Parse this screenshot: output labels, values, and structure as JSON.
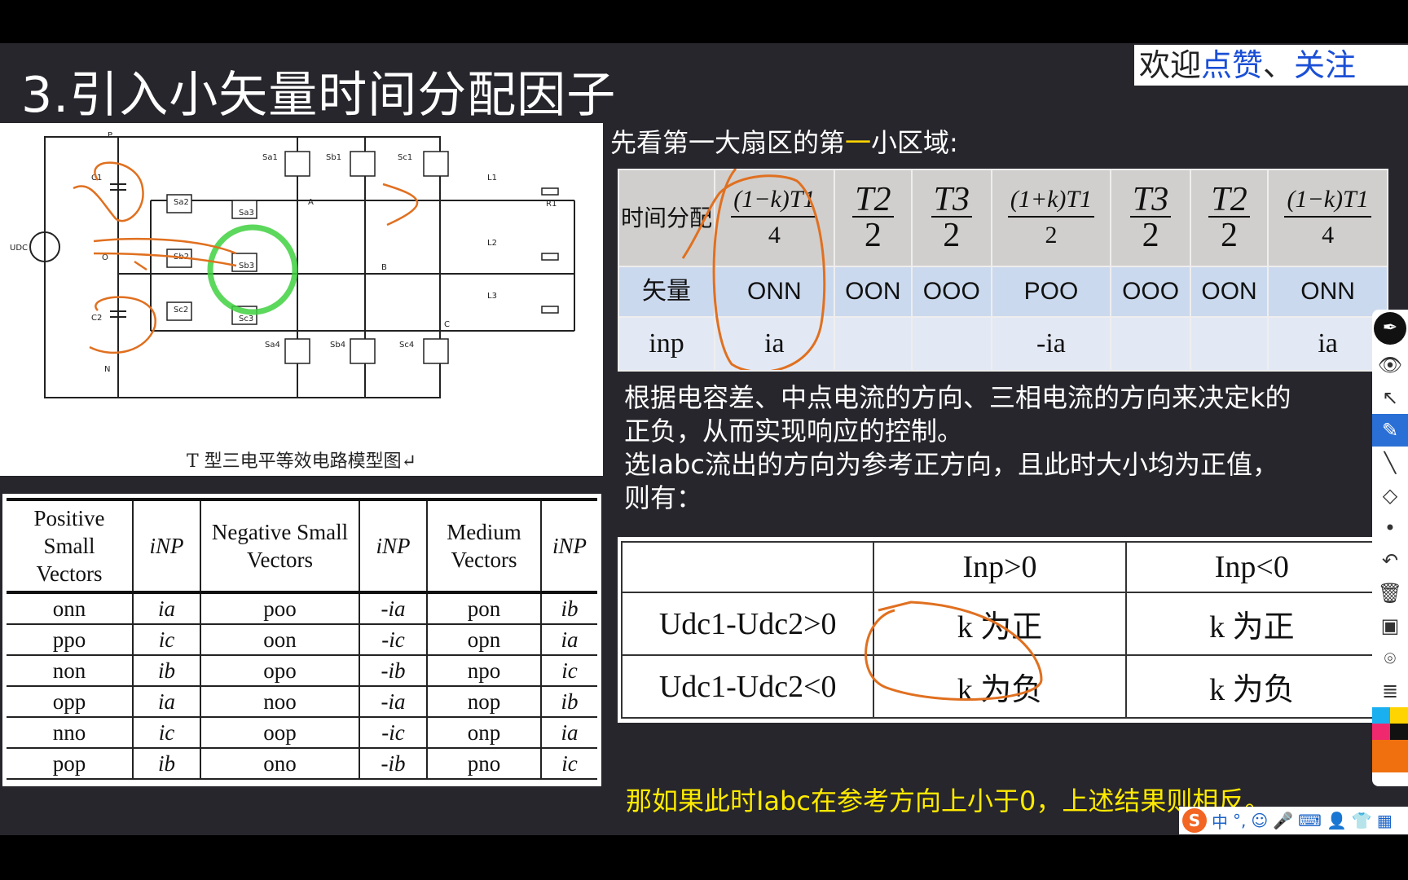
{
  "slide": {
    "title": "3.引入小矢量时间分配因子",
    "welcome_prefix": "欢迎",
    "welcome_blue1": "点赞",
    "welcome_sep": "、",
    "welcome_blue2": "关注"
  },
  "circuit": {
    "caption": "T 型三电平等效电路模型图↵",
    "labels": {
      "P": "P",
      "O": "O",
      "N": "N",
      "Udc": "UDC",
      "C1": "C1",
      "C2": "C2",
      "A": "A",
      "B": "B",
      "C": "C",
      "L1": "L1",
      "L2": "L2",
      "L3": "L3",
      "R1": "R1",
      "Sa1": "Sa1",
      "Sb1": "Sb1",
      "Sc1": "Sc1",
      "Sa2": "Sa2",
      "Sb2": "Sb2",
      "Sc2": "Sc2",
      "Sa3": "Sa3",
      "Sb3": "Sb3",
      "Sc3": "Sc3",
      "Sa4": "Sa4",
      "Sb4": "Sb4",
      "Sc4": "Sc4"
    }
  },
  "vector_table": {
    "headers": [
      "Positive Small Vectors",
      "iNP",
      "Negative Small Vectors",
      "iNP",
      "Medium Vectors",
      "iNP"
    ],
    "rows": [
      [
        "onn",
        "ia",
        "poo",
        "-ia",
        "pon",
        "ib"
      ],
      [
        "ppo",
        "ic",
        "oon",
        "-ic",
        "opn",
        "ia"
      ],
      [
        "non",
        "ib",
        "opo",
        "-ib",
        "npo",
        "ic"
      ],
      [
        "opp",
        "ia",
        "noo",
        "-ia",
        "nop",
        "ib"
      ],
      [
        "nno",
        "ic",
        "oop",
        "-ic",
        "onp",
        "ia"
      ],
      [
        "pop",
        "ib",
        "ono",
        "-ib",
        "pno",
        "ic"
      ]
    ]
  },
  "heading": {
    "pre": "先看第一大扇区的第",
    "hl": "一",
    "post": "小区域:"
  },
  "time_table": {
    "row_labels": [
      "时间分配",
      "矢量",
      "inp"
    ],
    "time": [
      {
        "n": "(1−k)T1",
        "d": "4"
      },
      {
        "n": "T2",
        "d": "2"
      },
      {
        "n": "T3",
        "d": "2"
      },
      {
        "n": "(1+k)T1",
        "d": "2"
      },
      {
        "n": "T3",
        "d": "2"
      },
      {
        "n": "T2",
        "d": "2"
      },
      {
        "n": "(1−k)T1",
        "d": "4"
      }
    ],
    "vectors": [
      "ONN",
      "OON",
      "OOO",
      "POO",
      "OOO",
      "OON",
      "ONN"
    ],
    "inp": [
      "ia",
      "",
      "",
      "-ia",
      "",
      "",
      "ia"
    ]
  },
  "paragraph": [
    "根据电容差、中点电流的方向、三相电流的方向来决定k的",
    "正负，从而实现响应的控制。",
    "选Iabc流出的方向为参考正方向，且此时大小均为正值，",
    "则有："
  ],
  "k_table": {
    "header": [
      "",
      "Inp>0",
      "Inp<0"
    ],
    "rows": [
      [
        "Udc1-Udc2>0",
        "k 为正",
        "k 为正"
      ],
      [
        "Udc1-Udc2<0",
        "k 为负",
        "k 为负"
      ]
    ]
  },
  "note": "那如果此时Iabc在参考方向上小于0，上述结果则相反。",
  "toolbar": {
    "icons": [
      "pen-icon",
      "eye-icon",
      "pointer-icon",
      "highlighter-icon",
      "line-icon",
      "eraser-icon",
      "dot-icon",
      "undo-icon",
      "trash-icon",
      "screen-icon",
      "camera-icon",
      "clipboard-icon",
      "color-palette-icon"
    ]
  },
  "ime": {
    "logo": "S",
    "lang": "中",
    "punct": "°,"
  },
  "colors": {
    "background": "#26262c",
    "annotation": "#e07020",
    "highlight": "#ffd400",
    "note": "#ffea00",
    "circle": "#3fd13f"
  }
}
